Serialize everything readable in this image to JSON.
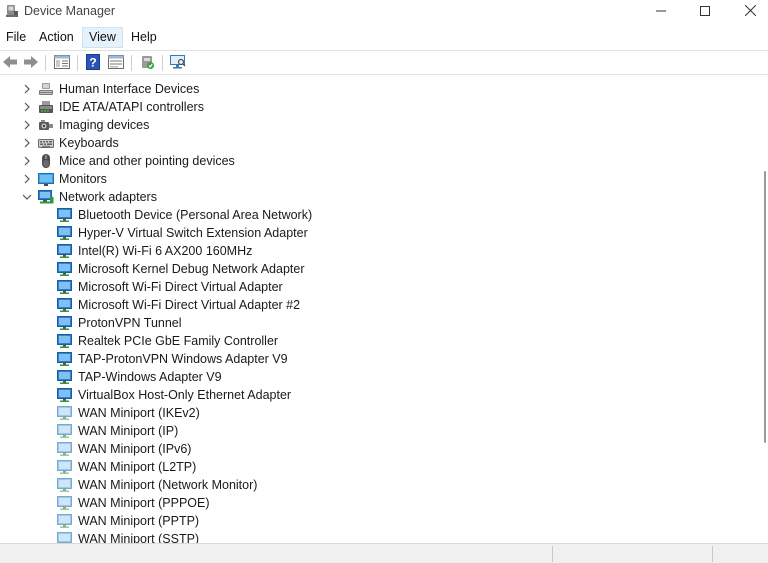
{
  "window": {
    "title": "Device Manager",
    "controls": {
      "minimize": "minimize-icon",
      "maximize": "maximize-icon",
      "close": "close-icon"
    }
  },
  "menu": {
    "items": [
      {
        "label": "File",
        "active": false
      },
      {
        "label": "Action",
        "active": false
      },
      {
        "label": "View",
        "active": true
      },
      {
        "label": "Help",
        "active": false
      }
    ]
  },
  "toolbar": {
    "buttons": [
      "back-icon",
      "forward-icon",
      "properties-icon",
      "help-icon",
      "show-hidden-icon",
      "update-driver-icon",
      "scan-hardware-icon"
    ]
  },
  "tree": {
    "categories": [
      {
        "label": "Human Interface Devices",
        "expanded": false,
        "icon": "hid-icon"
      },
      {
        "label": "IDE ATA/ATAPI controllers",
        "expanded": false,
        "icon": "ide-controller-icon"
      },
      {
        "label": "Imaging devices",
        "expanded": false,
        "icon": "camera-icon"
      },
      {
        "label": "Keyboards",
        "expanded": false,
        "icon": "keyboard-icon"
      },
      {
        "label": "Mice and other pointing devices",
        "expanded": false,
        "icon": "mouse-icon"
      },
      {
        "label": "Monitors",
        "expanded": false,
        "icon": "monitor-icon"
      },
      {
        "label": "Network adapters",
        "expanded": true,
        "icon": "network-adapter-icon"
      }
    ],
    "network_adapters": [
      "Bluetooth Device (Personal Area Network)",
      "Hyper-V Virtual Switch Extension Adapter",
      "Intel(R) Wi-Fi 6 AX200 160MHz",
      "Microsoft Kernel Debug Network Adapter",
      "Microsoft Wi-Fi Direct Virtual Adapter",
      "Microsoft Wi-Fi Direct Virtual Adapter #2",
      "ProtonVPN Tunnel",
      "Realtek PCIe GbE Family Controller",
      "TAP-ProtonVPN Windows Adapter V9",
      "TAP-Windows Adapter V9",
      "VirtualBox Host-Only Ethernet Adapter",
      "WAN Miniport (IKEv2)",
      "WAN Miniport (IP)",
      "WAN Miniport (IPv6)",
      "WAN Miniport (L2TP)",
      "WAN Miniport (Network Monitor)",
      "WAN Miniport (PPPOE)",
      "WAN Miniport (PPTP)",
      "WAN Miniport (SSTP)"
    ],
    "disabled_start_index": 11
  },
  "colors": {
    "menu_active_bg": "#e5f1fb",
    "adapter_icon": "#2f7fd0",
    "adapter_icon_disabled": "#9cc8ea",
    "monitor": "#3ba3e6"
  }
}
